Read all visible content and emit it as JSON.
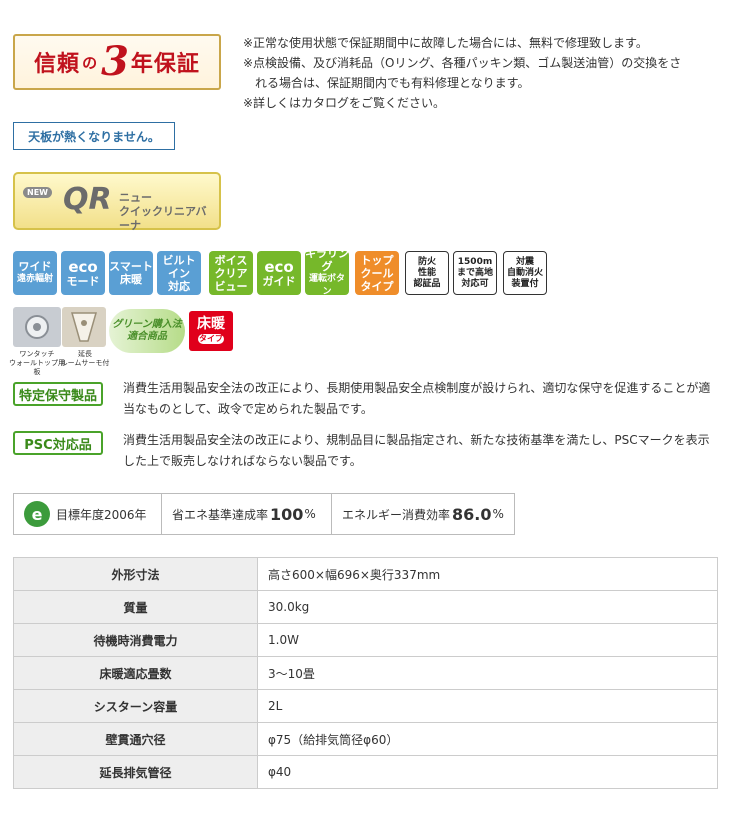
{
  "warranty": {
    "part1": "信頼",
    "part2": "の",
    "part3": "3",
    "part4": "年保証"
  },
  "notes": [
    "※正常な使用状態で保証期間中に故障した場合には、無料で修理致します。",
    "※点検設備、及び消耗品（Oリング、各種パッキン類、ゴム製送油管）の交換をさ",
    "れる場合は、保証期間内でも有料修理となります。",
    "※詳しくはカタログをご覧ください。"
  ],
  "tenban_label": "天板が熱くなりません。",
  "qr_logo": {
    "new": "NEW",
    "mark": "QR",
    "line1": "ニュー",
    "line2": "クイックリニアバーナ"
  },
  "feature_icons": [
    {
      "lines": [
        "ワイド",
        "遠赤輻射"
      ],
      "color": "blue"
    },
    {
      "lines": [
        "eco",
        "モード"
      ],
      "color": "blue"
    },
    {
      "lines": [
        "スマート",
        "床暖"
      ],
      "color": "blue"
    },
    {
      "lines": [
        "ビルト",
        "イン",
        "対応"
      ],
      "color": "blue"
    },
    {
      "lines": [
        "ボイス",
        "クリア",
        "ビュー"
      ],
      "color": "green"
    },
    {
      "lines": [
        "eco",
        "ガイド"
      ],
      "color": "green"
    },
    {
      "lines": [
        "キラリング",
        "運転ボタン"
      ],
      "color": "green"
    },
    {
      "lines": [
        "トップ",
        "クール",
        "タイプ"
      ],
      "color": "orange"
    },
    {
      "lines": [
        "防火",
        "性能",
        "認証品"
      ],
      "color": "outline"
    },
    {
      "lines": [
        "1500m",
        "まで高地",
        "対応可"
      ],
      "color": "outline"
    },
    {
      "lines": [
        "対震",
        "自動消火",
        "装置付"
      ],
      "color": "outline"
    }
  ],
  "onetouch_label": [
    "ワンタッチ",
    "ウォールトップ用板"
  ],
  "enchou_label": [
    "延長",
    "ルームサーモ付"
  ],
  "green_purchase": [
    "グリーン購入法",
    "適合商品"
  ],
  "yukadan": {
    "title": "床暖",
    "sub": "タイプ"
  },
  "specified_maintenance": {
    "tag": "特定保守製品",
    "desc": "消費生活用製品安全法の改正により、長期使用製品安全点検制度が設けられ、適切な保守を促進することが適当なものとして、政令で定められた製品です。"
  },
  "psc": {
    "tag": "PSC対応品",
    "desc": "消費生活用製品安全法の改正により、規制品目に製品指定され、新たな技術基準を満たし、PSCマークを表示した上で販売しなければならない製品です。"
  },
  "energy": {
    "mark": "e",
    "target_year": "目標年度2006年",
    "achieve_label": "省エネ基準達成率",
    "achieve_value": "100",
    "achieve_unit": "%",
    "efficiency_label": "エネルギー消費効率",
    "efficiency_value": "86.0",
    "efficiency_unit": "%"
  },
  "spec_table": [
    {
      "label": "外形寸法",
      "value": "高さ600×幅696×奥行337mm"
    },
    {
      "label": "質量",
      "value": "30.0kg"
    },
    {
      "label": "待機時消費電力",
      "value": "1.0W"
    },
    {
      "label": "床暖適応畳数",
      "value": "3～10畳"
    },
    {
      "label": "シスターン容量",
      "value": "2L"
    },
    {
      "label": "壁貫通穴径",
      "value": "φ75（給排気筒径φ60）"
    },
    {
      "label": "延長排気管径",
      "value": "φ40"
    }
  ],
  "colors": {
    "blue": "#5a9fd4",
    "green": "#76b82a",
    "orange": "#ef8d2a",
    "red": "#c0121d"
  }
}
